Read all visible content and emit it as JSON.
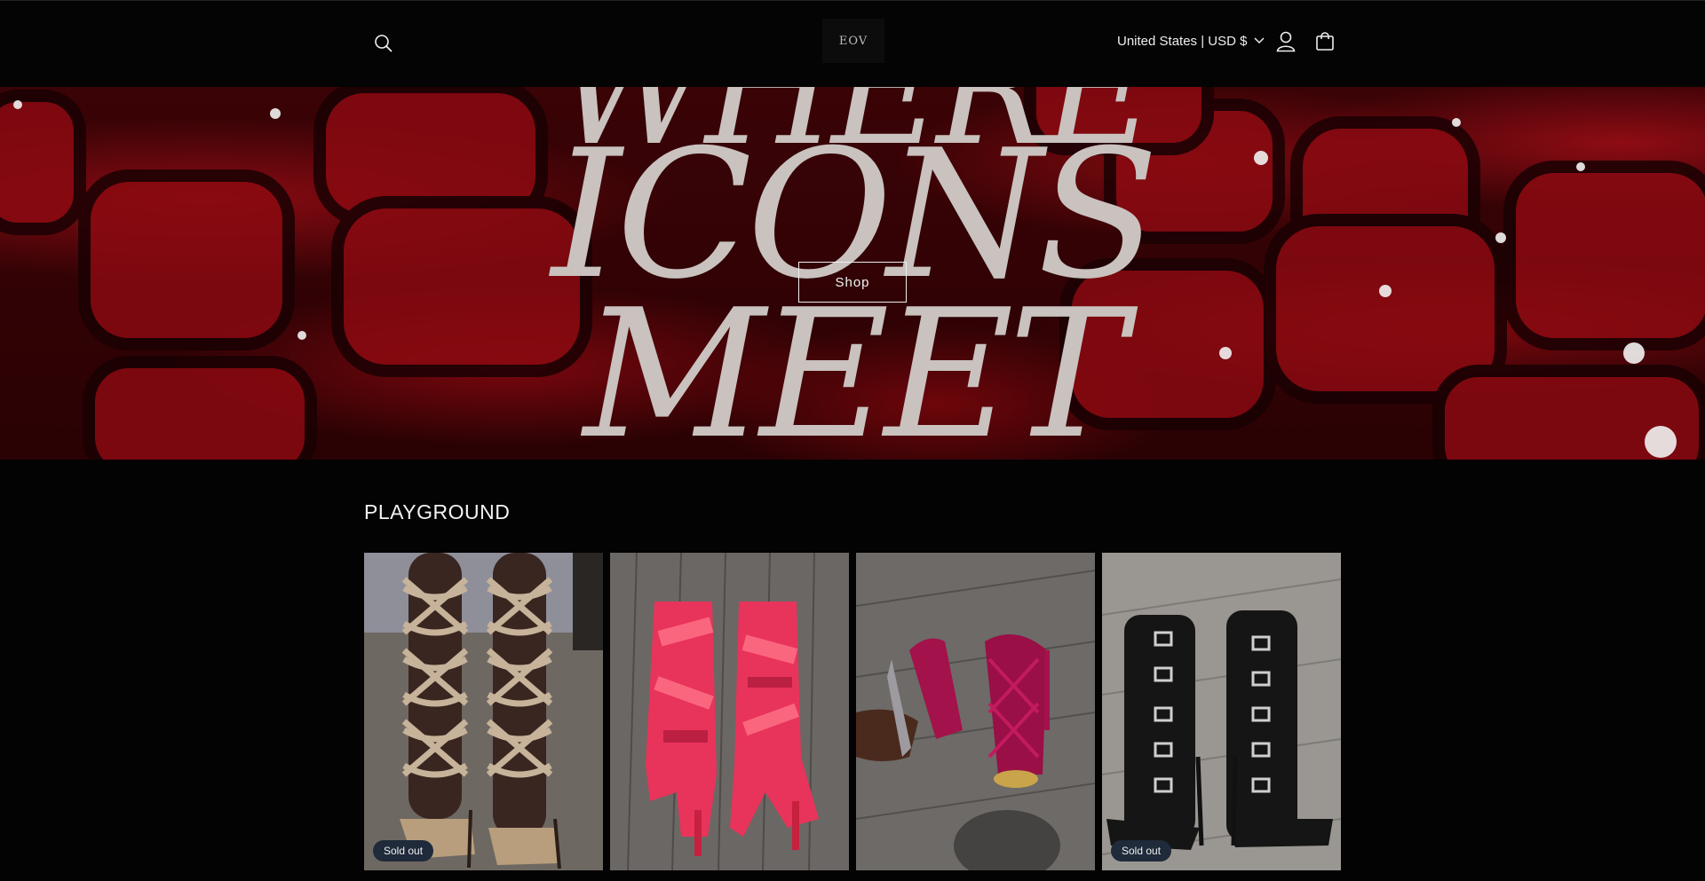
{
  "header": {
    "logo_text": "EOV",
    "country_label": "United States | USD $",
    "icons": [
      "search-icon",
      "account-icon",
      "cart-icon",
      "chevron-down-icon"
    ]
  },
  "hero": {
    "line1": "WHERE",
    "line2": "ICONS",
    "line3": "MEET",
    "shop_label": "Shop",
    "colors": {
      "background": "#5a0309",
      "text": "#c9c2bf"
    }
  },
  "collection": {
    "title": "PLAYGROUND",
    "products": [
      {
        "badge": "Sold out"
      },
      {
        "badge": ""
      },
      {
        "badge": ""
      },
      {
        "badge": "Sold out"
      }
    ]
  }
}
